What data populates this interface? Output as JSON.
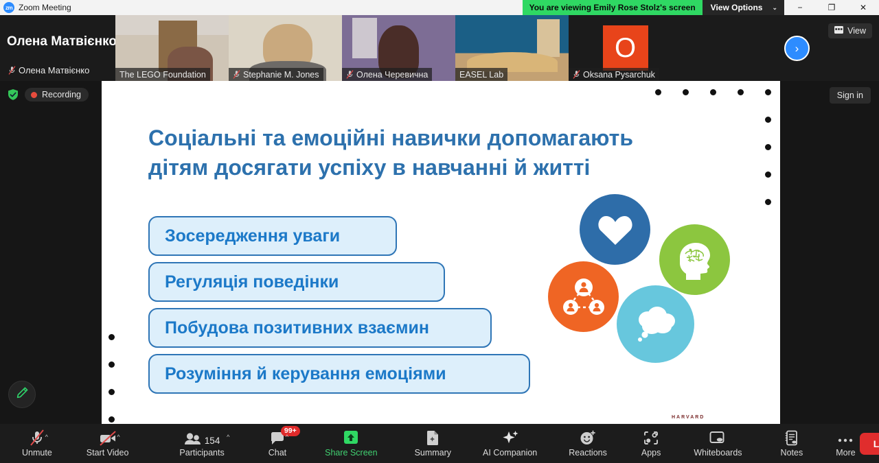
{
  "window": {
    "app_icon": "zoom-logo-icon",
    "title": "Zoom Meeting",
    "minimize": "−",
    "maximize": "❐",
    "close": "✕"
  },
  "share_banner": {
    "text": "You are viewing Emily Rose Stolz's screen",
    "view_options_label": "View Options",
    "caret": "⌄",
    "color": "#2fd863"
  },
  "thumbnails": {
    "self": {
      "display_name": "Олена Матвієнко",
      "name_label": "Олена Матвієнко",
      "muted": true
    },
    "items": [
      {
        "name": "The LEGO Foundation",
        "muted": false,
        "active_speaker": false,
        "cam": "cam-a"
      },
      {
        "name": "Stephanie M. Jones",
        "muted": true,
        "active_speaker": false,
        "cam": "cam-b"
      },
      {
        "name": "Олена Черевична",
        "muted": true,
        "active_speaker": false,
        "cam": "cam-c"
      },
      {
        "name": "EASEL Lab",
        "muted": false,
        "active_speaker": true,
        "cam": "cam-d"
      },
      {
        "name": "Oksana Pysarchuk",
        "muted": true,
        "active_speaker": false,
        "cam": "avatar",
        "avatar_letter": "O",
        "avatar_color": "#e8441a"
      }
    ],
    "view_button": {
      "label": "View",
      "icon": "grid-view-icon"
    }
  },
  "stage": {
    "encryption_icon": "shield-check-icon",
    "recording_label": "Recording",
    "annotate_icon": "pencil-icon",
    "next_arrow_icon": "chevron-right-icon",
    "sign_in_label": "Sign in"
  },
  "slide": {
    "title_line1": "Соціальні та емоційні навички допомагають",
    "title_line2": "дітям досягати успіху в навчанні й житті",
    "title_color": "#2d71ad",
    "skills": [
      "Зосередження уваги",
      "Регуляція поведінки",
      "Побудова позитивних взаємин",
      "Розуміння й керування емоціями"
    ],
    "skill_box_fill": "#ddeffb",
    "skill_box_border": "#2e75b6",
    "skill_text_color": "#1c79c8",
    "icons": [
      {
        "name": "heart-icon",
        "color": "#2e6da9"
      },
      {
        "name": "brain-head-icon",
        "color": "#8cc63f"
      },
      {
        "name": "people-network-icon",
        "color": "#ef6524"
      },
      {
        "name": "thought-cloud-icon",
        "color": "#67c7dd"
      }
    ],
    "footer_mark": "HARVARD"
  },
  "toolbar": {
    "items": [
      {
        "label": "Unmute",
        "icon": "mic-muted-icon",
        "caret": true
      },
      {
        "label": "Start Video",
        "icon": "video-off-icon",
        "caret": true
      },
      {
        "label": "Participants",
        "icon": "people-icon",
        "count": "154",
        "caret": true
      },
      {
        "label": "Chat",
        "icon": "chat-icon",
        "badge": "99+",
        "caret": true
      },
      {
        "label": "Share Screen",
        "icon": "share-screen-icon",
        "active": true
      },
      {
        "label": "Summary",
        "icon": "summary-doc-icon"
      },
      {
        "label": "AI Companion",
        "icon": "sparkles-icon"
      },
      {
        "label": "Reactions",
        "icon": "smiley-plus-icon"
      },
      {
        "label": "Apps",
        "icon": "apps-icon"
      },
      {
        "label": "Whiteboards",
        "icon": "whiteboard-icon"
      },
      {
        "label": "Notes",
        "icon": "notes-icon"
      },
      {
        "label": "More",
        "icon": "ellipsis-icon"
      }
    ],
    "leave_label": "Leave",
    "leave_color": "#e02d2d"
  }
}
